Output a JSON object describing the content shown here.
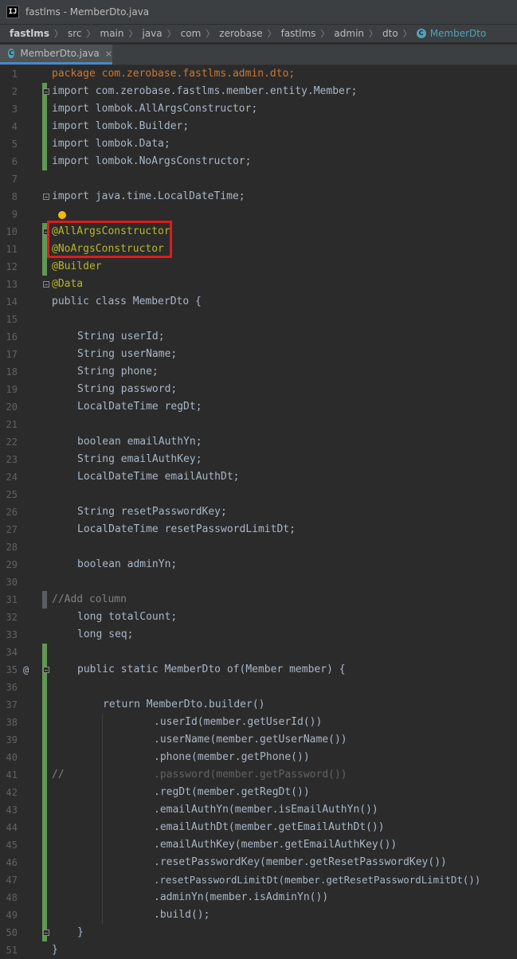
{
  "window": {
    "title": "fastlms - MemberDto.java",
    "app_icon_text": "IJ"
  },
  "breadcrumb": {
    "items": [
      "fastlms",
      "src",
      "main",
      "java",
      "com",
      "zerobase",
      "fastlms",
      "admin",
      "dto"
    ],
    "current": "MemberDto"
  },
  "tab": {
    "label": "MemberDto.java",
    "close": "×"
  },
  "colors": {
    "keyword": "#cc7832",
    "annotation": "#bbb529",
    "field": "#9876aa",
    "method": "#ffc66d",
    "comment": "#808080",
    "highlight_box": "#e01b1b"
  },
  "lines": [
    {
      "n": "1",
      "t": "package com.zerobase.fastlms.admin.dto;"
    },
    {
      "n": "2",
      "t": "import com.zerobase.fastlms.member.entity.Member;"
    },
    {
      "n": "3",
      "t": "import lombok.AllArgsConstructor;"
    },
    {
      "n": "4",
      "t": "import lombok.Builder;"
    },
    {
      "n": "5",
      "t": "import lombok.Data;"
    },
    {
      "n": "6",
      "t": "import lombok.NoArgsConstructor;"
    },
    {
      "n": "7",
      "t": ""
    },
    {
      "n": "8",
      "t": "import java.time.LocalDateTime;"
    },
    {
      "n": "9",
      "t": ""
    },
    {
      "n": "10",
      "t": "@AllArgsConstructor"
    },
    {
      "n": "11",
      "t": "@NoArgsConstructor"
    },
    {
      "n": "12",
      "t": "@Builder"
    },
    {
      "n": "13",
      "t": "@Data"
    },
    {
      "n": "14",
      "t": "public class MemberDto {"
    },
    {
      "n": "15",
      "t": ""
    },
    {
      "n": "16",
      "t": "String userId;"
    },
    {
      "n": "17",
      "t": "String userName;"
    },
    {
      "n": "18",
      "t": "String phone;"
    },
    {
      "n": "19",
      "t": "String password;"
    },
    {
      "n": "20",
      "t": "LocalDateTime regDt;"
    },
    {
      "n": "21",
      "t": ""
    },
    {
      "n": "22",
      "t": "boolean emailAuthYn;"
    },
    {
      "n": "23",
      "t": "String emailAuthKey;"
    },
    {
      "n": "24",
      "t": "LocalDateTime emailAuthDt;"
    },
    {
      "n": "25",
      "t": ""
    },
    {
      "n": "26",
      "t": "String resetPasswordKey;"
    },
    {
      "n": "27",
      "t": "LocalDateTime resetPasswordLimitDt;"
    },
    {
      "n": "28",
      "t": ""
    },
    {
      "n": "29",
      "t": "boolean adminYn;"
    },
    {
      "n": "30",
      "t": ""
    },
    {
      "n": "31",
      "t": "//Add column"
    },
    {
      "n": "32",
      "t": "long totalCount;"
    },
    {
      "n": "33",
      "t": "long seq;"
    },
    {
      "n": "34",
      "t": ""
    },
    {
      "n": "35",
      "t": "public static MemberDto of(Member member) {"
    },
    {
      "n": "36",
      "t": ""
    },
    {
      "n": "37",
      "t": "return MemberDto.builder()"
    },
    {
      "n": "38",
      "t": ".userId(member.getUserId())"
    },
    {
      "n": "39",
      "t": ".userName(member.getUserName())"
    },
    {
      "n": "40",
      "t": ".phone(member.getPhone())"
    },
    {
      "n": "41",
      "t": ".password(member.getPassword())"
    },
    {
      "n": "42",
      "t": ".regDt(member.getRegDt())"
    },
    {
      "n": "43",
      "t": ".emailAuthYn(member.isEmailAuthYn())"
    },
    {
      "n": "44",
      "t": ".emailAuthDt(member.getEmailAuthDt())"
    },
    {
      "n": "45",
      "t": ".emailAuthKey(member.getEmailAuthKey())"
    },
    {
      "n": "46",
      "t": ".resetPasswordKey(member.getResetPasswordKey())"
    },
    {
      "n": "47",
      "t": ".resetPasswordLimitDt(member.getResetPasswordLimitDt())"
    },
    {
      "n": "48",
      "t": ".adminYn(member.isAdminYn())"
    },
    {
      "n": "49",
      "t": ".build();"
    },
    {
      "n": "50",
      "t": "}"
    },
    {
      "n": "51",
      "t": "}"
    }
  ],
  "gutter": {
    "override_marker": "@",
    "comment_prefix": "//"
  }
}
